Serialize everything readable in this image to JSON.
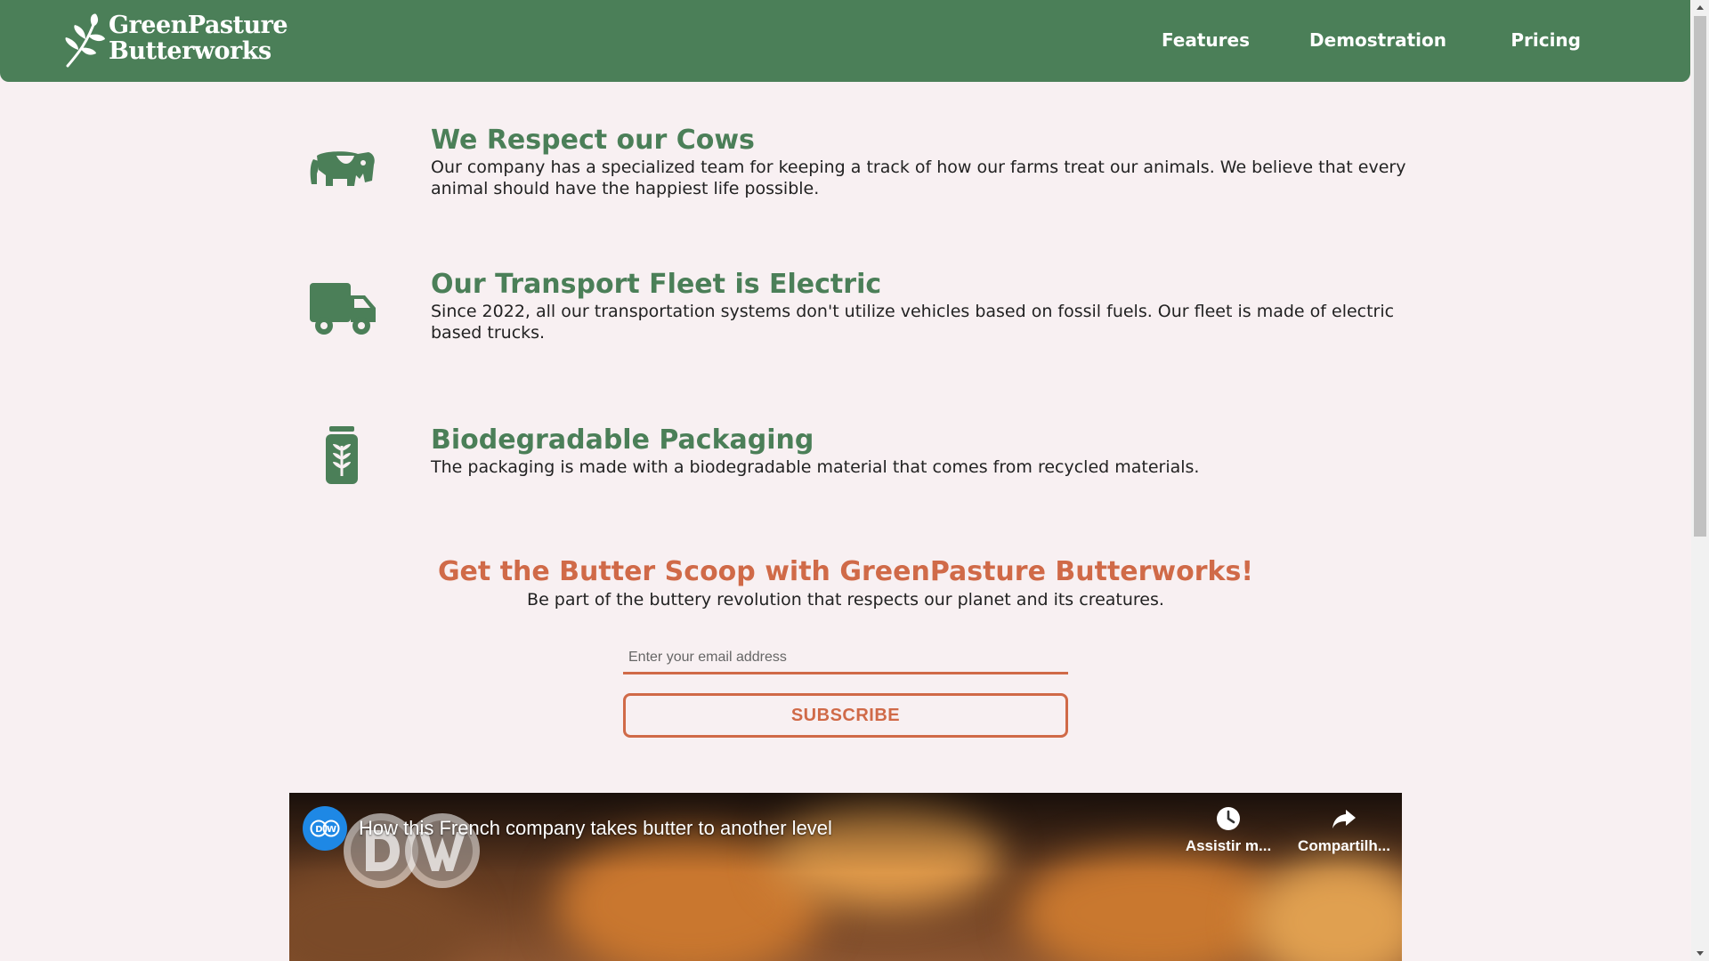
{
  "brand": {
    "name_line1": "GreenPasture",
    "name_line2": "Butterworks"
  },
  "nav": {
    "items": [
      {
        "label": "Features"
      },
      {
        "label": "Demostration"
      },
      {
        "label": "Pricing"
      }
    ]
  },
  "features": [
    {
      "icon": "cow-icon",
      "title": "We Respect our Cows",
      "description": "Our company has a specialized team for keeping a track of how our farms treat our animals. We believe that every animal should have the happiest life possible."
    },
    {
      "icon": "truck-icon",
      "title": "Our Transport Fleet is Electric",
      "description": "Since 2022, all our transportation systems don't utilize vehicles based on fossil fuels. Our fleet is made of electric based trucks."
    },
    {
      "icon": "jar-icon",
      "title": "Biodegradable Packaging",
      "description": "The packaging is made with a biodegradable material that comes from recycled materials."
    }
  ],
  "subscribe": {
    "title": "Get the Butter Scoop with GreenPasture Butterworks!",
    "subtitle": "Be part of the buttery revolution that respects our planet and its creatures.",
    "email_placeholder": "Enter your email address",
    "button_label": "SUBSCRIBE"
  },
  "video": {
    "title": "How this French company takes butter to another level",
    "watch_later_label": "Assistir m...",
    "share_label": "Compartilh..."
  },
  "colors": {
    "primary_green": "#4b7f58",
    "accent_orange": "#d06a48",
    "background": "#f8f0f2"
  }
}
